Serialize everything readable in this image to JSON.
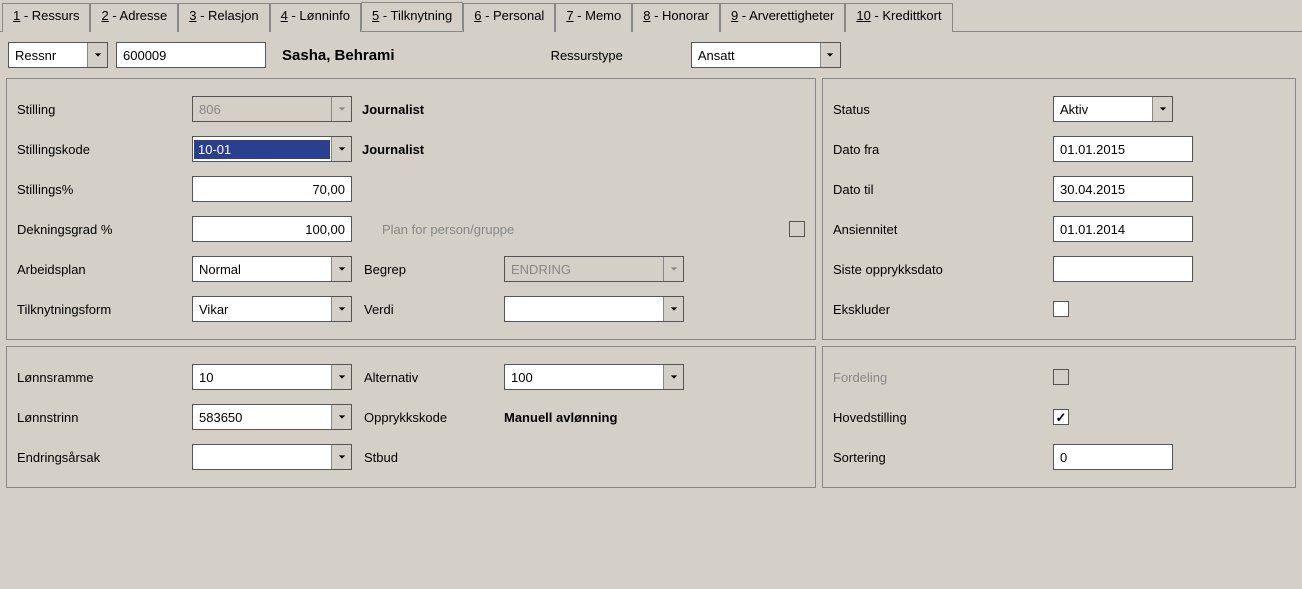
{
  "tabs": [
    {
      "num": "1",
      "label": "Ressurs"
    },
    {
      "num": "2",
      "label": "Adresse"
    },
    {
      "num": "3",
      "label": "Relasjon"
    },
    {
      "num": "4",
      "label": "Lønninfo"
    },
    {
      "num": "5",
      "label": "Tilknytning"
    },
    {
      "num": "6",
      "label": "Personal"
    },
    {
      "num": "7",
      "label": "Memo"
    },
    {
      "num": "8",
      "label": "Honorar"
    },
    {
      "num": "9",
      "label": "Arverettigheter"
    },
    {
      "num": "10",
      "label": "Kredittkort"
    }
  ],
  "active_tab_index": 4,
  "toolbar": {
    "search_field_label": "Ressnr",
    "ressnr_value": "600009",
    "person_name": "Sasha, Behrami",
    "ressurstype_label": "Ressurstype",
    "ressurstype_value": "Ansatt"
  },
  "left1": {
    "stilling_label": "Stilling",
    "stilling_value": "806",
    "stilling_desc": "Journalist",
    "stillingskode_label": "Stillingskode",
    "stillingskode_value": "10-01",
    "stillingskode_desc": "Journalist",
    "stillingspct_label": "Stillings%",
    "stillingspct_value": "70,00",
    "dekning_label": "Dekningsgrad %",
    "dekning_value": "100,00",
    "plan_label": "Plan for person/gruppe",
    "arbeidsplan_label": "Arbeidsplan",
    "arbeidsplan_value": "Normal",
    "begrep_label": "Begrep",
    "begrep_value": "ENDRING",
    "tilknytning_label": "Tilknytningsform",
    "tilknytning_value": "Vikar",
    "verdi_label": "Verdi",
    "verdi_value": ""
  },
  "left2": {
    "lonnsramme_label": "Lønnsramme",
    "lonnsramme_value": "10",
    "alternativ_label": "Alternativ",
    "alternativ_value": "100",
    "lonnstrinn_label": "Lønnstrinn",
    "lonnstrinn_value": "583650",
    "opprykkskode_label": "Opprykkskode",
    "opprykkskode_desc": "Manuell avlønning",
    "endringsarsak_label": "Endringsårsak",
    "endringsarsak_value": "",
    "stbud_label": "Stbud"
  },
  "right1": {
    "status_label": "Status",
    "status_value": "Aktiv",
    "datofra_label": "Dato fra",
    "datofra_value": "01.01.2015",
    "datotil_label": "Dato til",
    "datotil_value": "30.04.2015",
    "ansiennitet_label": "Ansiennitet",
    "ansiennitet_value": "01.01.2014",
    "sisteopprykk_label": "Siste opprykksdato",
    "sisteopprykk_value": "",
    "ekskluder_label": "Ekskluder",
    "ekskluder_checked": false
  },
  "right2": {
    "fordeling_label": "Fordeling",
    "fordeling_checked": false,
    "hovedstilling_label": "Hovedstilling",
    "hovedstilling_checked": true,
    "sortering_label": "Sortering",
    "sortering_value": "0"
  }
}
